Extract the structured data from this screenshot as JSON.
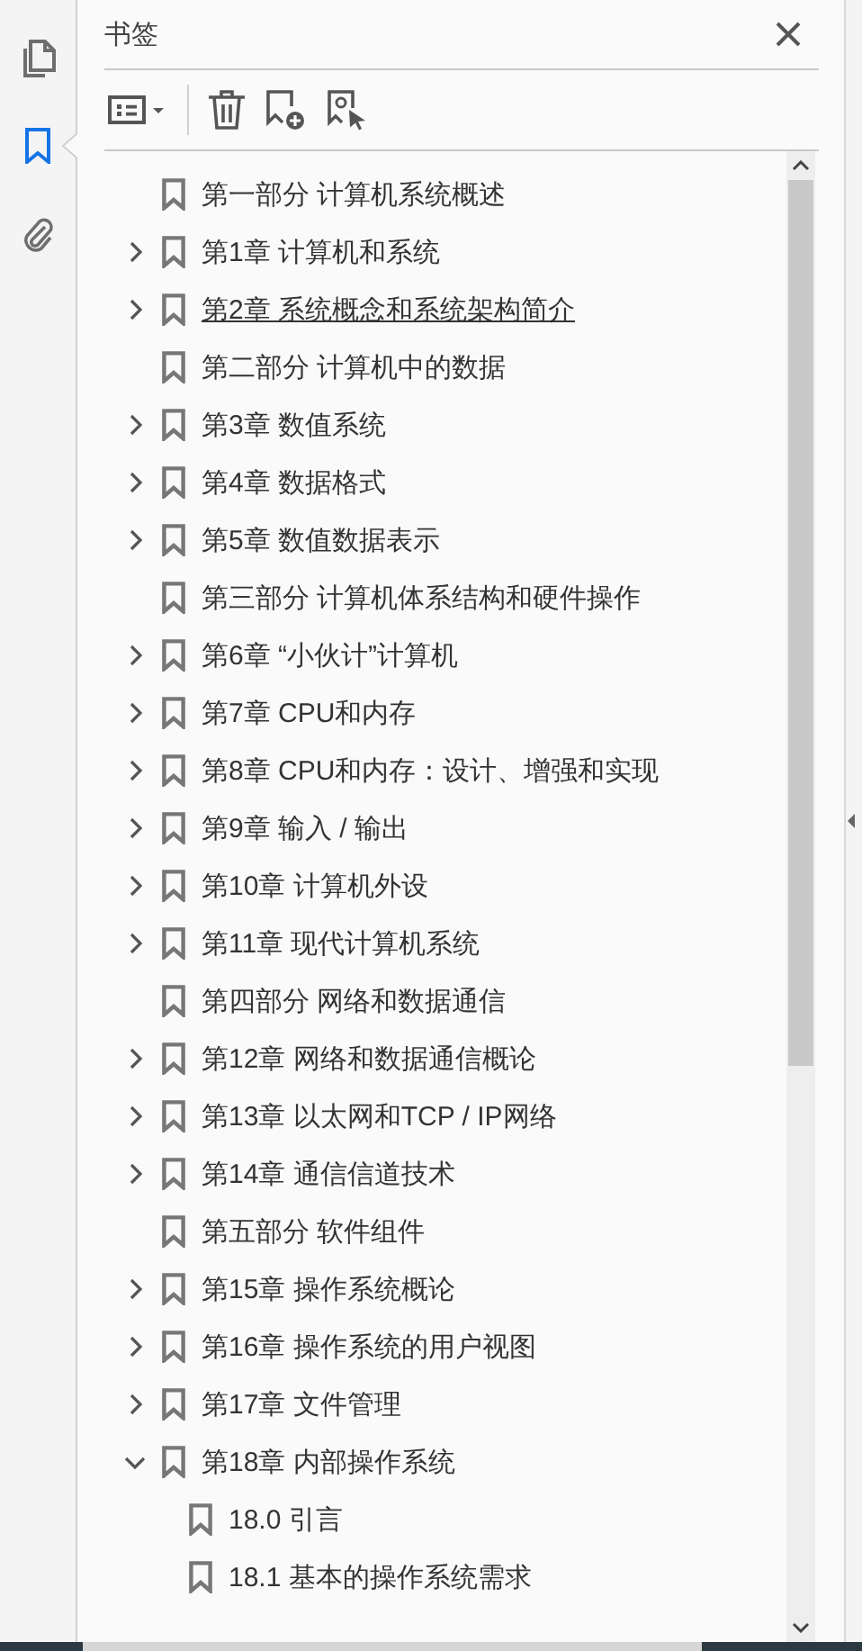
{
  "rail": [
    {
      "kind": "pages",
      "selected": false
    },
    {
      "kind": "bookmarks",
      "selected": true
    },
    {
      "kind": "attachments",
      "selected": false
    }
  ],
  "panel": {
    "title": "书签"
  },
  "bookmarks": [
    {
      "label": "第一部分 计算机系统概述",
      "hovered": false
    },
    {
      "label": "第1章 计算机和系统",
      "expanded": false,
      "hovered": false
    },
    {
      "label": "第2章 系统概念和系统架构简介",
      "expanded": false,
      "hovered": true
    },
    {
      "label": "第二部分 计算机中的数据",
      "hovered": false
    },
    {
      "label": "第3章 数值系统",
      "expanded": false,
      "hovered": false
    },
    {
      "label": "第4章 数据格式",
      "expanded": false,
      "hovered": false
    },
    {
      "label": "第5章 数值数据表示",
      "expanded": false,
      "hovered": false
    },
    {
      "label": "第三部分 计算机体系结构和硬件操作",
      "hovered": false
    },
    {
      "label": "第6章 “小伙计”计算机",
      "expanded": false,
      "hovered": false
    },
    {
      "label": "第7章 CPU和内存",
      "expanded": false,
      "hovered": false
    },
    {
      "label": "第8章 CPU和内存：设计、增强和实现",
      "expanded": false,
      "hovered": false
    },
    {
      "label": "第9章 输入 / 输出",
      "expanded": false,
      "hovered": false
    },
    {
      "label": "第10章 计算机外设",
      "expanded": false,
      "hovered": false
    },
    {
      "label": "第11章 现代计算机系统",
      "expanded": false,
      "hovered": false
    },
    {
      "label": "第四部分 网络和数据通信",
      "hovered": false
    },
    {
      "label": "第12章 网络和数据通信概论",
      "expanded": false,
      "hovered": false
    },
    {
      "label": "第13章 以太网和TCP / IP网络",
      "expanded": false,
      "hovered": false
    },
    {
      "label": "第14章 通信信道技术",
      "expanded": false,
      "hovered": false
    },
    {
      "label": "第五部分 软件组件",
      "hovered": false
    },
    {
      "label": "第15章 操作系统概论",
      "expanded": false,
      "hovered": false
    },
    {
      "label": "第16章 操作系统的用户视图",
      "expanded": false,
      "hovered": false
    },
    {
      "label": "第17章 文件管理",
      "expanded": false,
      "hovered": false
    },
    {
      "label": "第18章 内部操作系统",
      "expanded": true,
      "hovered": false,
      "children": [
        {
          "label": "18.0 引言",
          "hovered": false
        },
        {
          "label": "18.1 基本的操作系统需求",
          "hovered": false
        }
      ]
    }
  ]
}
